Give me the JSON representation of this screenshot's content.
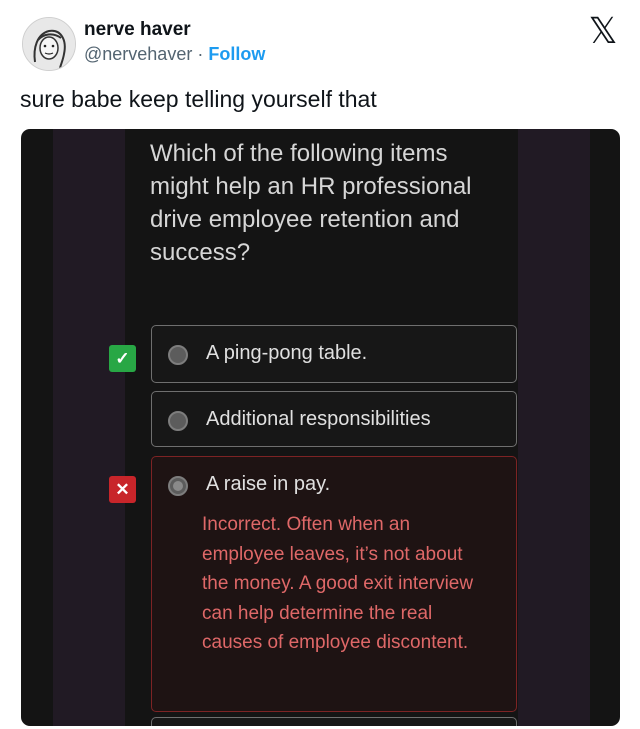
{
  "tweet": {
    "display_name": "nerve haver",
    "handle": "@nervehaver",
    "separator": "·",
    "follow_label": "Follow",
    "close_glyph": "𝕏",
    "text": "sure babe keep telling yourself that"
  },
  "quiz": {
    "question": "Which of the following items might help an HR professional drive employee retention and success?",
    "options": [
      {
        "label": "A ping-pong table.",
        "mark": "✓",
        "status": "correct"
      },
      {
        "label": "Additional responsibilities",
        "mark": "",
        "status": "none"
      },
      {
        "label": "A raise in pay.",
        "mark": "✕",
        "status": "incorrect",
        "selected": true,
        "feedback": "Incorrect. Often when an employee leaves, it’s not about the money. A good exit interview can help determine the real causes of employee discontent."
      }
    ]
  },
  "colors": {
    "follow_blue": "#1d9bf0",
    "correct_green": "#28a745",
    "incorrect_red": "#c8252a",
    "feedback_text": "#df6868"
  }
}
